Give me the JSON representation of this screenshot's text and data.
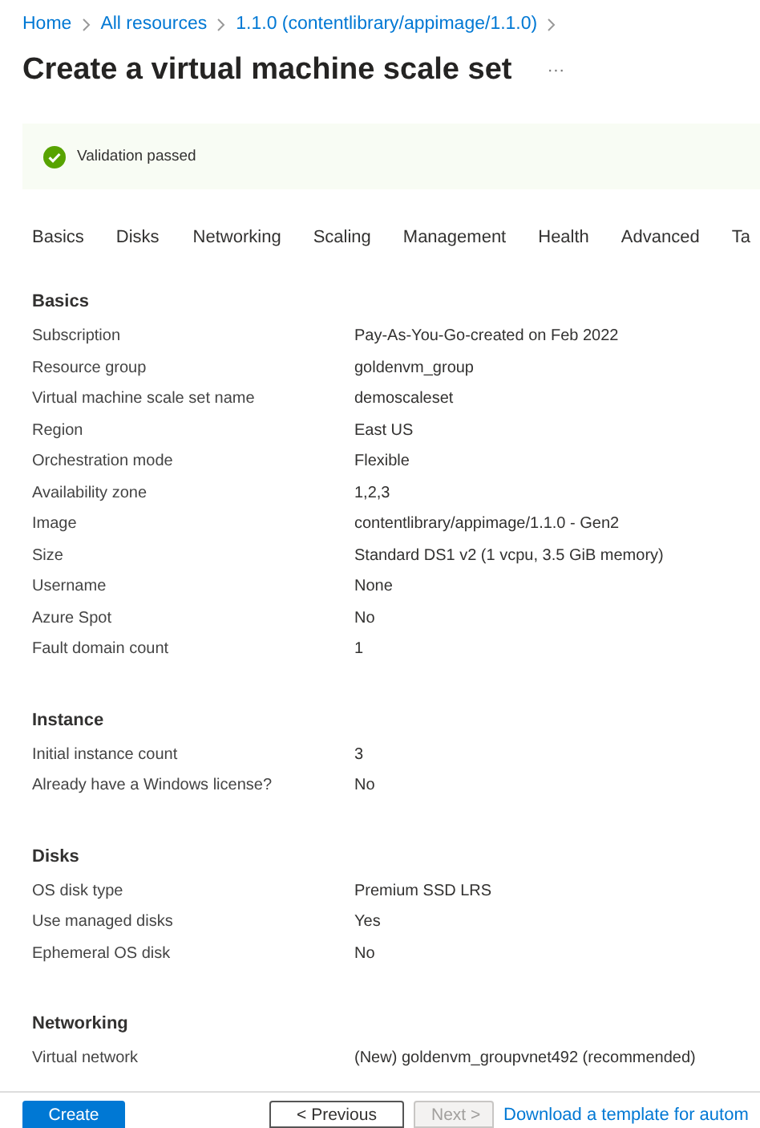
{
  "breadcrumb": [
    "Home",
    "All resources",
    "1.1.0 (contentlibrary/appimage/1.1.0)"
  ],
  "title": "Create a virtual machine scale set",
  "more_menu": "···",
  "validation": {
    "message": "Validation passed"
  },
  "tabs": [
    "Basics",
    "Disks",
    "Networking",
    "Scaling",
    "Management",
    "Health",
    "Advanced",
    "Ta"
  ],
  "sections": [
    {
      "heading": "Basics",
      "rows": [
        {
          "label": "Subscription",
          "value": "Pay-As-You-Go-created on Feb 2022"
        },
        {
          "label": "Resource group",
          "value": "goldenvm_group"
        },
        {
          "label": "Virtual machine scale set name",
          "value": "demoscaleset"
        },
        {
          "label": "Region",
          "value": "East US"
        },
        {
          "label": "Orchestration mode",
          "value": "Flexible"
        },
        {
          "label": "Availability zone",
          "value": "1,2,3"
        },
        {
          "label": "Image",
          "value": "contentlibrary/appimage/1.1.0 - Gen2"
        },
        {
          "label": "Size",
          "value": "Standard DS1 v2 (1 vcpu, 3.5 GiB memory)"
        },
        {
          "label": "Username",
          "value": "None"
        },
        {
          "label": "Azure Spot",
          "value": "No"
        },
        {
          "label": "Fault domain count",
          "value": "1"
        }
      ]
    },
    {
      "heading": "Instance",
      "rows": [
        {
          "label": "Initial instance count",
          "value": "3"
        },
        {
          "label": "Already have a Windows license?",
          "value": "No"
        }
      ]
    },
    {
      "heading": "Disks",
      "rows": [
        {
          "label": "OS disk type",
          "value": "Premium SSD LRS"
        },
        {
          "label": "Use managed disks",
          "value": "Yes"
        },
        {
          "label": "Ephemeral OS disk",
          "value": "No"
        }
      ]
    },
    {
      "heading": "Networking",
      "rows": [
        {
          "label": "Virtual network",
          "value": "(New) goldenvm_groupvnet492 (recommended)"
        }
      ]
    }
  ],
  "footer": {
    "create": "Create",
    "previous": "< Previous",
    "next": "Next >",
    "next_disabled": true,
    "download": "Download a template for autom"
  }
}
